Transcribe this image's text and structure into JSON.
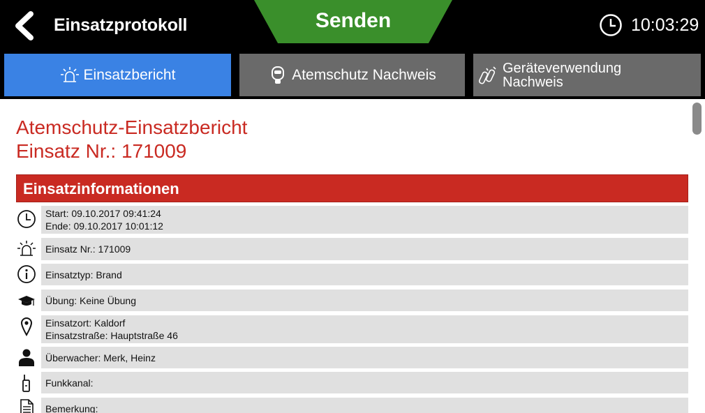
{
  "header": {
    "title": "Einsatzprotokoll",
    "send_label": "Senden",
    "time": "10:03:29"
  },
  "tabs": [
    {
      "label": "Einsatzbericht",
      "icon": "siren-icon",
      "active": true
    },
    {
      "label": "Atemschutz Nachweis",
      "icon": "breathing-mask-icon",
      "active": false
    },
    {
      "label": "Geräteverwendung Nachweis",
      "icon": "oxygen-bottles-icon",
      "active": false
    }
  ],
  "report": {
    "title": "Atemschutz-Einsatzbericht",
    "number": "Einsatz Nr.: 171009",
    "section_title": "Einsatzinformationen",
    "rows": [
      {
        "icon": "clock-icon",
        "lines": [
          "Start: 09.10.2017 09:41:24",
          "Ende: 09.10.2017 10:01:12"
        ]
      },
      {
        "icon": "siren-icon",
        "lines": [
          "Einsatz Nr.: 171009"
        ]
      },
      {
        "icon": "info-icon",
        "lines": [
          "Einsatztyp: Brand"
        ]
      },
      {
        "icon": "graduation-cap-icon",
        "lines": [
          "Übung: Keine Übung"
        ]
      },
      {
        "icon": "location-pin-icon",
        "lines": [
          "Einsatzort: Kaldorf",
          "Einsatzstraße: Hauptstraße 46"
        ]
      },
      {
        "icon": "person-icon",
        "lines": [
          "Überwacher: Merk, Heinz"
        ]
      },
      {
        "icon": "radio-icon",
        "lines": [
          "Funkkanal:"
        ]
      },
      {
        "icon": "document-icon",
        "lines": [
          "Bemerkung:"
        ]
      }
    ]
  },
  "colors": {
    "accent_red": "#c92a22",
    "send_green": "#3a8f2b",
    "tab_active": "#3a82e4",
    "tab_inactive": "#6a6a6a",
    "row_bg": "#e0e0e0"
  }
}
